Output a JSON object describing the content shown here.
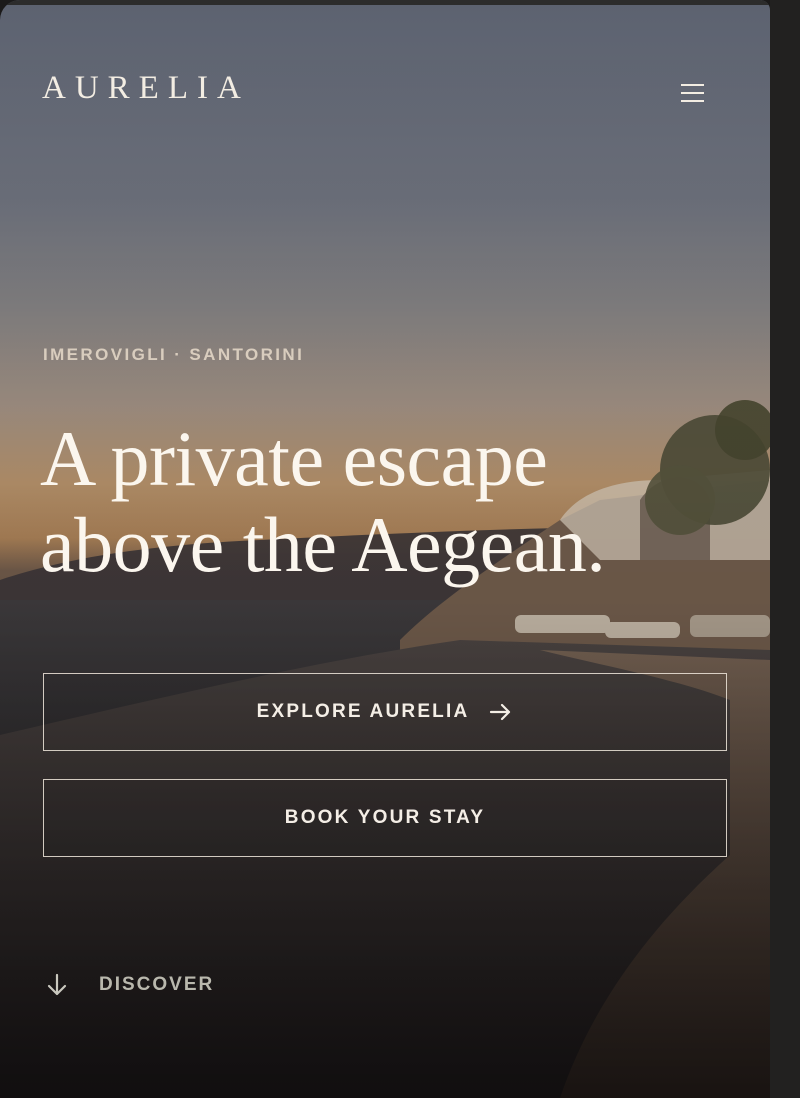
{
  "header": {
    "logo": "AURELIA",
    "menu_icon": "hamburger-menu-icon"
  },
  "hero": {
    "location": "IMEROVIGLI · SANTORINI",
    "headline_line1": "A private escape",
    "headline_line2": "above the Aegean."
  },
  "actions": {
    "explore_label": "EXPLORE AURELIA",
    "explore_icon": "arrow-right-icon",
    "book_label": "BOOK YOUR STAY"
  },
  "discover": {
    "label": "DISCOVER",
    "icon": "arrow-down-icon"
  },
  "colors": {
    "text_light": "#fbf6ee",
    "muted": "#b9b8ad",
    "sky_top": "#5f6573",
    "horizon": "#b48a5c",
    "dark": "#191716"
  }
}
